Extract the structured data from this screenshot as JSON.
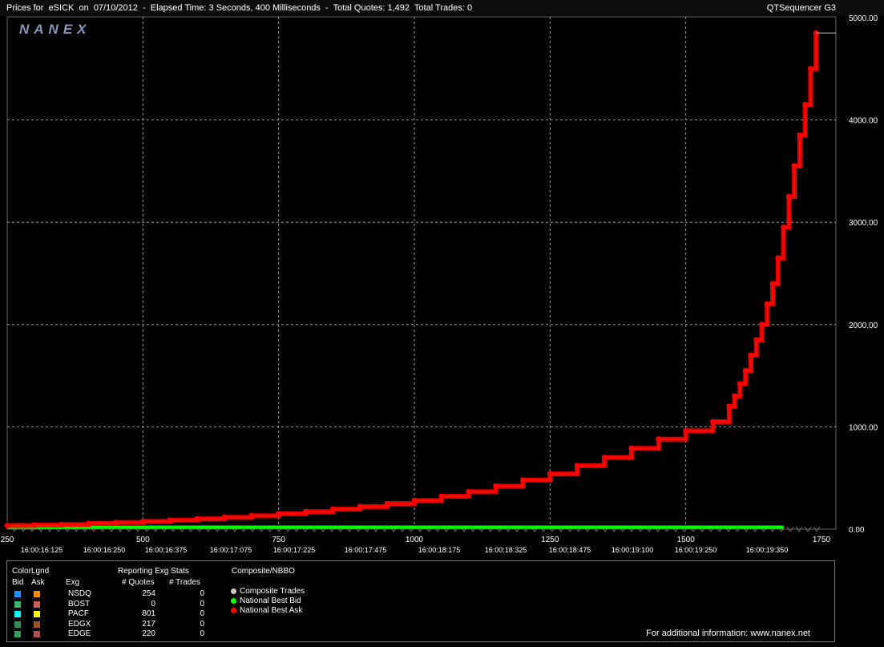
{
  "header": {
    "title": "Prices for  eSICK  on  07/10/2012  -  Elapsed Time: 3 Seconds, 400 Milliseconds  -  Total Quotes: 1,492  Total Trades: 0",
    "right": "QTSequencer G3"
  },
  "logo": "NANEX",
  "colors": {
    "background": "#000000",
    "grid": "#9a9a9a",
    "ask": "#ff0000",
    "bid": "#00ff00",
    "ask_line": "#ffa500"
  },
  "chart_data": {
    "type": "scatter",
    "title": "",
    "xlabel": "",
    "ylabel": "",
    "xlim": [
      250,
      1750
    ],
    "ylim": [
      0,
      5000
    ],
    "x_ticks": [
      "250",
      "500",
      "750",
      "1000",
      "1250",
      "1500",
      "1750"
    ],
    "y_ticks": [
      "0.00",
      "1000.00",
      "2000.00",
      "3000.00",
      "4000.00",
      "5000.00"
    ],
    "time_labels": [
      "16:00:16:125",
      "16:00:16:250",
      "16:00:16:375",
      "16:00:17:075",
      "16:00:17:225",
      "16:00:17:475",
      "16:00:18:175",
      "16:00:18:325",
      "16:00:18:475",
      "16:00:19:100",
      "16:00:19:250",
      "16:00:19:350"
    ],
    "grid": true,
    "series": [
      {
        "name": "National Best Ask",
        "x": [
          250,
          300,
          350,
          400,
          450,
          500,
          550,
          600,
          650,
          700,
          750,
          800,
          850,
          900,
          950,
          1000,
          1050,
          1100,
          1150,
          1200,
          1250,
          1300,
          1350,
          1400,
          1450,
          1500,
          1550,
          1580,
          1590,
          1600,
          1610,
          1620,
          1630,
          1640,
          1650,
          1660,
          1670,
          1680,
          1690,
          1700,
          1710,
          1720,
          1730,
          1740
        ],
        "values": [
          35,
          40,
          45,
          55,
          65,
          75,
          88,
          100,
          115,
          130,
          150,
          170,
          195,
          220,
          250,
          280,
          320,
          365,
          420,
          480,
          540,
          620,
          700,
          790,
          880,
          960,
          1050,
          1200,
          1300,
          1420,
          1550,
          1700,
          1850,
          2000,
          2200,
          2400,
          2650,
          2950,
          3250,
          3550,
          3850,
          4150,
          4500,
          4850
        ]
      },
      {
        "name": "National Best Bid",
        "x": [
          250,
          1680
        ],
        "values": [
          20,
          20
        ]
      }
    ]
  },
  "legend": {
    "col_title_1": "ColorLgnd",
    "col_title_2": "Reporting Exg Stats",
    "col_title_3": "Composite/NBBO",
    "h_bid": "Bid",
    "h_ask": "Ask",
    "h_exg": "Exg",
    "h_quotes": "# Quotes",
    "h_trades": "# Trades",
    "rows": [
      {
        "exg": "NSDQ",
        "quotes": "254",
        "trades": "0",
        "bid_color": "#1e90ff",
        "ask_color": "#ff8c00"
      },
      {
        "exg": "BOST",
        "quotes": "0",
        "trades": "0",
        "bid_color": "#3cb371",
        "ask_color": "#cd5c5c"
      },
      {
        "exg": "PACF",
        "quotes": "801",
        "trades": "0",
        "bid_color": "#00ffff",
        "ask_color": "#ffff00"
      },
      {
        "exg": "EDGX",
        "quotes": "217",
        "trades": "0",
        "bid_color": "#2e8b57",
        "ask_color": "#a0522d"
      },
      {
        "exg": "EDGE",
        "quotes": "220",
        "trades": "0",
        "bid_color": "#3c9a5a",
        "ask_color": "#b05050"
      }
    ],
    "nbbo": [
      {
        "label": "Composite Trades",
        "color": "#cccccc"
      },
      {
        "label": "National Best Bid",
        "color": "#00ff00"
      },
      {
        "label": "National Best Ask",
        "color": "#ff0000"
      }
    ],
    "footer": "For additional information: www.nanex.net"
  }
}
